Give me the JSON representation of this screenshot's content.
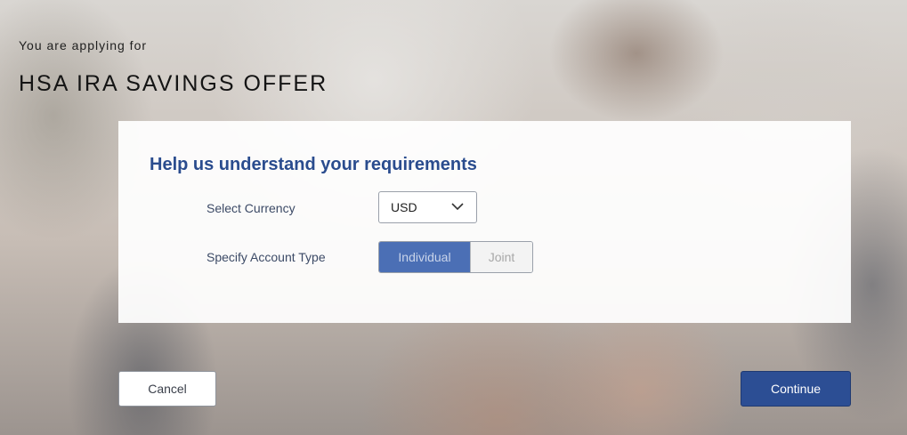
{
  "header": {
    "intro": "You are applying for",
    "product_name": "HSA IRA SAVINGS OFFER"
  },
  "form": {
    "title": "Help us understand your requirements",
    "currency_label": "Select Currency",
    "currency_value": "USD",
    "account_type_label": "Specify Account Type",
    "account_type_options": [
      "Individual",
      "Joint"
    ],
    "account_type_selected": "Individual"
  },
  "actions": {
    "cancel_label": "Cancel",
    "continue_label": "Continue"
  },
  "icons": {
    "dropdown": "chevron-down-icon"
  },
  "colors": {
    "title": "#2a4c8e",
    "selected_toggle": "#4b6fb5",
    "primary_button": "#2c4e94"
  }
}
